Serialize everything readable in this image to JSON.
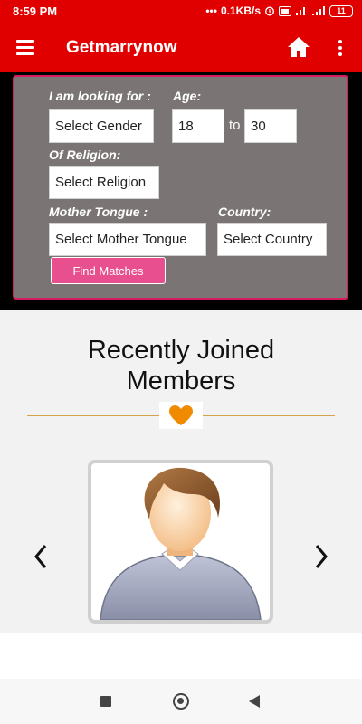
{
  "status_bar": {
    "time": "8:59 PM",
    "speed": "0.1KB/s",
    "battery": "11"
  },
  "app_bar": {
    "title": "Getmarrynow"
  },
  "search": {
    "looking_for_label": "I am looking for :",
    "age_label": "Age:",
    "gender_value": "Select Gender",
    "age_from": "18",
    "to_text": "to",
    "age_to": "30",
    "religion_label": "Of Religion:",
    "religion_value": "Select Religion",
    "mother_tongue_label": "Mother Tongue :",
    "country_label": "Country:",
    "mother_tongue_value": "Select Mother Tongue",
    "country_value": "Select Country",
    "find_button": "Find Matches"
  },
  "members": {
    "title_line1": "Recently Joined",
    "title_line2": "Members"
  },
  "colors": {
    "brand_red": "#e10000",
    "panel_gray": "#7a7574",
    "accent_pink": "#e84f8f",
    "heart_orange": "#f08a00"
  }
}
